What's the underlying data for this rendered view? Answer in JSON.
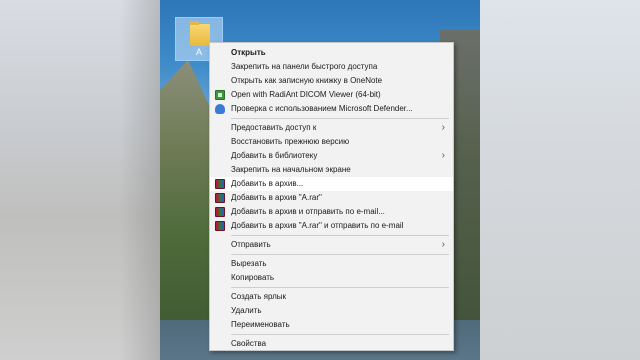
{
  "desktop": {
    "folder_label": "A"
  },
  "menu": {
    "groups": [
      [
        {
          "label": "Открыть",
          "bold": true,
          "icon": "",
          "submenu": false
        },
        {
          "label": "Закрепить на панели быстрого доступа",
          "icon": "",
          "submenu": false
        },
        {
          "label": "Открыть как записную книжку в OneNote",
          "icon": "",
          "submenu": false
        },
        {
          "label": "Open with RadiAnt DICOM Viewer (64-bit)",
          "icon": "radiant-icon",
          "submenu": false
        },
        {
          "label": "Проверка с использованием Microsoft Defender...",
          "icon": "defender-shield-icon",
          "submenu": false
        }
      ],
      [
        {
          "label": "Предоставить доступ к",
          "icon": "",
          "submenu": true
        },
        {
          "label": "Восстановить прежнюю версию",
          "icon": "",
          "submenu": false
        },
        {
          "label": "Добавить в библиотеку",
          "icon": "",
          "submenu": true
        },
        {
          "label": "Закрепить на начальном экране",
          "icon": "",
          "submenu": false
        },
        {
          "label": "Добавить в архив...",
          "icon": "winrar-icon",
          "submenu": false,
          "highlight": true
        },
        {
          "label": "Добавить в архив \"A.rar\"",
          "icon": "winrar-icon",
          "submenu": false
        },
        {
          "label": "Добавить в архив и отправить по e-mail...",
          "icon": "winrar-icon",
          "submenu": false
        },
        {
          "label": "Добавить в архив \"A.rar\" и отправить по e-mail",
          "icon": "winrar-icon",
          "submenu": false
        }
      ],
      [
        {
          "label": "Отправить",
          "icon": "",
          "submenu": true
        }
      ],
      [
        {
          "label": "Вырезать",
          "icon": "",
          "submenu": false
        },
        {
          "label": "Копировать",
          "icon": "",
          "submenu": false
        }
      ],
      [
        {
          "label": "Создать ярлык",
          "icon": "",
          "submenu": false
        },
        {
          "label": "Удалить",
          "icon": "",
          "submenu": false
        },
        {
          "label": "Переименовать",
          "icon": "",
          "submenu": false
        }
      ],
      [
        {
          "label": "Свойства",
          "icon": "",
          "submenu": false
        }
      ]
    ]
  }
}
